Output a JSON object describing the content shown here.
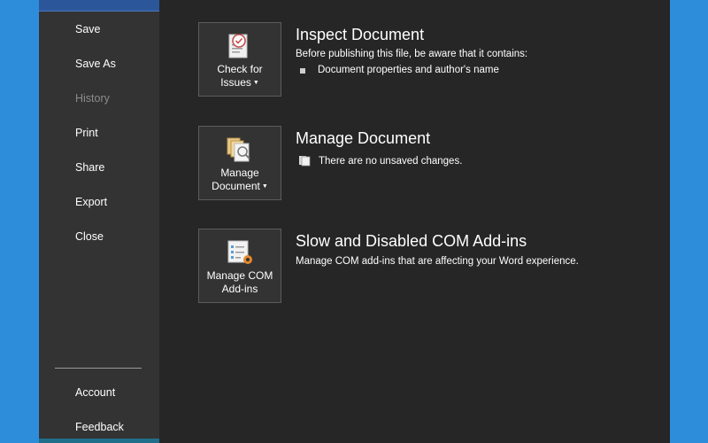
{
  "sidebar": {
    "items": [
      {
        "label": "Save"
      },
      {
        "label": "Save As"
      },
      {
        "label": "History"
      },
      {
        "label": "Print"
      },
      {
        "label": "Share"
      },
      {
        "label": "Export"
      },
      {
        "label": "Close"
      }
    ],
    "bottom_items": [
      {
        "label": "Account"
      },
      {
        "label": "Feedback"
      }
    ]
  },
  "sections": [
    {
      "tile_line1": "Check for",
      "tile_line2": "Issues",
      "tile_icon": "check-document-icon",
      "title": "Inspect Document",
      "description": "Before publishing this file, be aware that it contains:",
      "bullets": [
        "Document properties and author's name"
      ]
    },
    {
      "tile_line1": "Manage",
      "tile_line2": "Document",
      "tile_icon": "manage-document-icon",
      "title": "Manage Document",
      "status_text": "There are no unsaved changes."
    },
    {
      "tile_line1": "Manage COM",
      "tile_line2": "Add-ins",
      "tile_icon": "com-addins-icon",
      "title": "Slow and Disabled COM Add-ins",
      "description": "Manage COM add-ins that are affecting your Word experience."
    }
  ],
  "colors": {
    "desktop": "#2e8ddb",
    "window_bg": "#262626",
    "sidebar_bg": "#333333",
    "accent": "#2b579a"
  }
}
